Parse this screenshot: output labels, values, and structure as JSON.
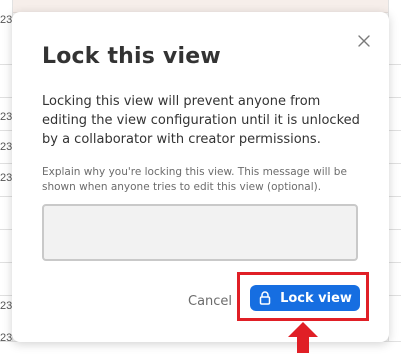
{
  "modal": {
    "title": "Lock this view",
    "description": "Locking this view will prevent anyone from editing the view configuration until it is unlocked by a collaborator with creator permissions.",
    "hint": "Explain why you're locking this view. This message will be shown when anyone tries to edit this view (optional).",
    "reason_value": "",
    "cancel_label": "Cancel",
    "lock_label": "Lock view",
    "close_icon": "close-icon",
    "lock_icon": "lock-icon"
  },
  "background": {
    "row_fragments": [
      "23",
      "23",
      "23",
      "23",
      "23",
      "23"
    ]
  },
  "colors": {
    "primary": "#166ee1",
    "highlight": "#e01f26",
    "text": "#333333",
    "muted": "#6c6c6c"
  }
}
